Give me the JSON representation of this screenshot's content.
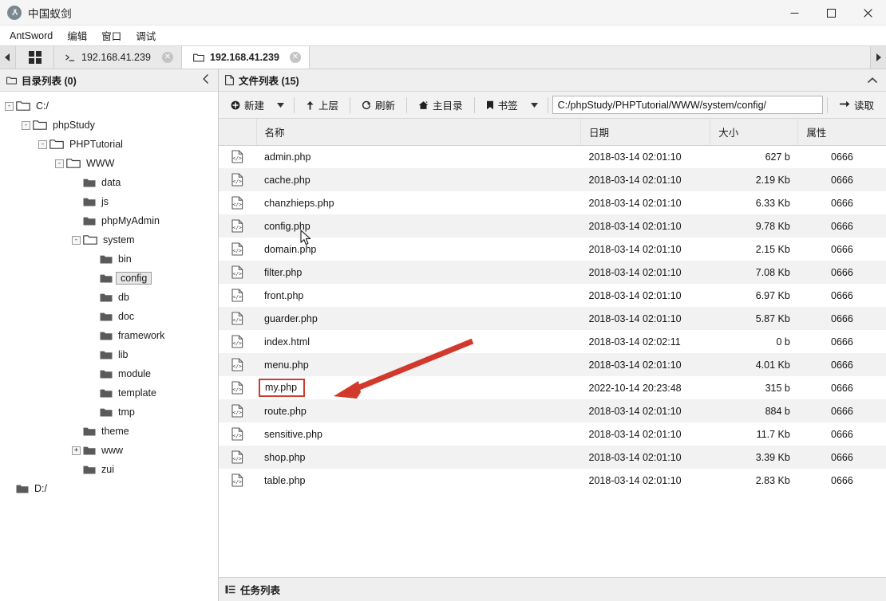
{
  "window": {
    "title": "中国蚁剑",
    "logo_icon": "antsword-logo-icon",
    "minimize_label": "—",
    "maximize_label": "□",
    "close_label": "✕"
  },
  "menubar": {
    "items": [
      {
        "label": "AntSword"
      },
      {
        "label": "编辑"
      },
      {
        "label": "窗口"
      },
      {
        "label": "调试"
      }
    ]
  },
  "tabbar": {
    "scroll_left_icon": "caret-left-icon",
    "scroll_right_icon": "caret-right-icon",
    "grid_button_icon": "grid-icon",
    "tabs": [
      {
        "icon": "terminal-icon",
        "label": "192.168.41.239",
        "close_label": "✕",
        "active": false
      },
      {
        "icon": "folder-icon",
        "label": "192.168.41.239",
        "close_label": "✕",
        "active": true
      }
    ]
  },
  "left_panel": {
    "header": {
      "icon": "folder-outline-icon",
      "title": "目录列表 (0)",
      "collapse_icon": "chevron-left-icon"
    },
    "tree": [
      {
        "label": "C:/",
        "depth": 0,
        "toggle": "-",
        "folder": "open",
        "selected": false
      },
      {
        "label": "phpStudy",
        "depth": 1,
        "toggle": "-",
        "folder": "open",
        "selected": false
      },
      {
        "label": "PHPTutorial",
        "depth": 2,
        "toggle": "-",
        "folder": "open",
        "selected": false
      },
      {
        "label": "WWW",
        "depth": 3,
        "toggle": "-",
        "folder": "open",
        "selected": false
      },
      {
        "label": "data",
        "depth": 4,
        "toggle": "",
        "folder": "solid",
        "selected": false
      },
      {
        "label": "js",
        "depth": 4,
        "toggle": "",
        "folder": "solid",
        "selected": false
      },
      {
        "label": "phpMyAdmin",
        "depth": 4,
        "toggle": "",
        "folder": "solid",
        "selected": false
      },
      {
        "label": "system",
        "depth": 4,
        "toggle": "-",
        "folder": "open",
        "selected": false
      },
      {
        "label": "bin",
        "depth": 5,
        "toggle": "",
        "folder": "solid",
        "selected": false
      },
      {
        "label": "config",
        "depth": 5,
        "toggle": "",
        "folder": "solid",
        "selected": true
      },
      {
        "label": "db",
        "depth": 5,
        "toggle": "",
        "folder": "solid",
        "selected": false
      },
      {
        "label": "doc",
        "depth": 5,
        "toggle": "",
        "folder": "solid",
        "selected": false
      },
      {
        "label": "framework",
        "depth": 5,
        "toggle": "",
        "folder": "solid",
        "selected": false
      },
      {
        "label": "lib",
        "depth": 5,
        "toggle": "",
        "folder": "solid",
        "selected": false
      },
      {
        "label": "module",
        "depth": 5,
        "toggle": "",
        "folder": "solid",
        "selected": false
      },
      {
        "label": "template",
        "depth": 5,
        "toggle": "",
        "folder": "solid",
        "selected": false
      },
      {
        "label": "tmp",
        "depth": 5,
        "toggle": "",
        "folder": "solid",
        "selected": false
      },
      {
        "label": "theme",
        "depth": 4,
        "toggle": "",
        "folder": "solid",
        "selected": false
      },
      {
        "label": "www",
        "depth": 4,
        "toggle": "+",
        "folder": "solid",
        "selected": false
      },
      {
        "label": "zui",
        "depth": 4,
        "toggle": "",
        "folder": "solid",
        "selected": false
      },
      {
        "label": "D:/",
        "depth": 0,
        "toggle": "",
        "folder": "solid",
        "selected": false
      }
    ]
  },
  "right_panel": {
    "header": {
      "icon": "file-outline-icon",
      "title": "文件列表 (15)",
      "collapse_icon": "chevron-up-icon"
    },
    "toolbar": {
      "new_label": "新建",
      "new_icon": "plus-circle-icon",
      "new_caret_icon": "caret-down-icon",
      "up_label": "上层",
      "up_icon": "arrow-up-icon",
      "refresh_label": "刷新",
      "refresh_icon": "refresh-icon",
      "home_label": "主目录",
      "home_icon": "home-icon",
      "bookmark_label": "书签",
      "bookmark_icon": "bookmark-icon",
      "bookmark_caret_icon": "caret-down-icon",
      "path_value": "C:/phpStudy/PHPTutorial/WWW/system/config/",
      "path_placeholder": "",
      "read_label": "读取",
      "read_icon": "arrow-right-icon"
    },
    "table": {
      "columns": [
        "",
        "名称",
        "日期",
        "大小",
        "属性"
      ],
      "file_icon": "code-file-icon",
      "rows": [
        {
          "name": "admin.php",
          "date": "2018-03-14 02:01:10",
          "size": "627 b",
          "attr": "0666",
          "highlighted": false
        },
        {
          "name": "cache.php",
          "date": "2018-03-14 02:01:10",
          "size": "2.19 Kb",
          "attr": "0666",
          "highlighted": false
        },
        {
          "name": "chanzhieps.php",
          "date": "2018-03-14 02:01:10",
          "size": "6.33 Kb",
          "attr": "0666",
          "highlighted": false
        },
        {
          "name": "config.php",
          "date": "2018-03-14 02:01:10",
          "size": "9.78 Kb",
          "attr": "0666",
          "highlighted": false
        },
        {
          "name": "domain.php",
          "date": "2018-03-14 02:01:10",
          "size": "2.15 Kb",
          "attr": "0666",
          "highlighted": false
        },
        {
          "name": "filter.php",
          "date": "2018-03-14 02:01:10",
          "size": "7.08 Kb",
          "attr": "0666",
          "highlighted": false
        },
        {
          "name": "front.php",
          "date": "2018-03-14 02:01:10",
          "size": "6.97 Kb",
          "attr": "0666",
          "highlighted": false
        },
        {
          "name": "guarder.php",
          "date": "2018-03-14 02:01:10",
          "size": "5.87 Kb",
          "attr": "0666",
          "highlighted": false
        },
        {
          "name": "index.html",
          "date": "2018-03-14 02:02:11",
          "size": "0 b",
          "attr": "0666",
          "highlighted": false
        },
        {
          "name": "menu.php",
          "date": "2018-03-14 02:01:10",
          "size": "4.01 Kb",
          "attr": "0666",
          "highlighted": false
        },
        {
          "name": "my.php",
          "date": "2022-10-14 20:23:48",
          "size": "315 b",
          "attr": "0666",
          "highlighted": true
        },
        {
          "name": "route.php",
          "date": "2018-03-14 02:01:10",
          "size": "884 b",
          "attr": "0666",
          "highlighted": false
        },
        {
          "name": "sensitive.php",
          "date": "2018-03-14 02:01:10",
          "size": "11.7 Kb",
          "attr": "0666",
          "highlighted": false
        },
        {
          "name": "shop.php",
          "date": "2018-03-14 02:01:10",
          "size": "3.39 Kb",
          "attr": "0666",
          "highlighted": false
        },
        {
          "name": "table.php",
          "date": "2018-03-14 02:01:10",
          "size": "2.83 Kb",
          "attr": "0666",
          "highlighted": false
        }
      ]
    }
  },
  "statusbar": {
    "icon": "tasklist-icon",
    "title": "任务列表"
  },
  "annotations": {
    "highlight_color": "#d03b2e",
    "arrow_color": "#d0392b",
    "arrow_from": "590,429",
    "arrow_to": "418,497",
    "cursor_icon": "mouse-pointer-icon"
  }
}
